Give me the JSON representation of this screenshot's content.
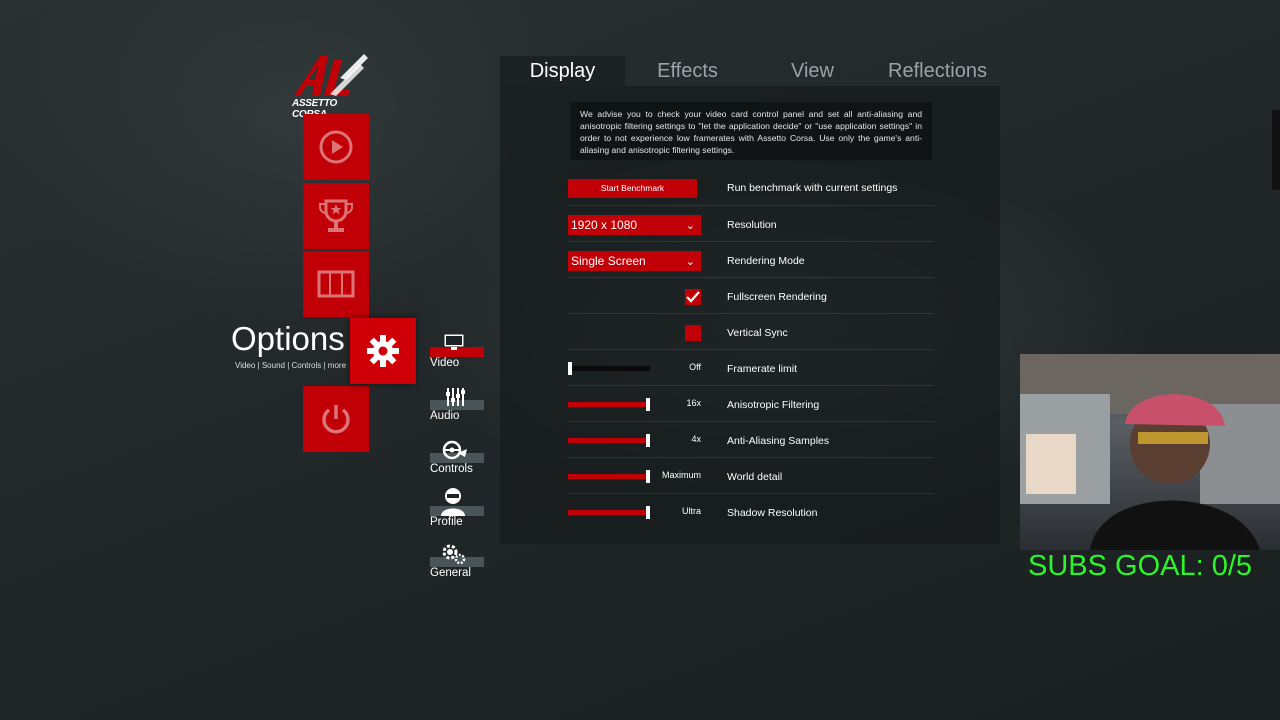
{
  "logo": {
    "text": "ASSETTO CORSA"
  },
  "main_menu": {
    "options_title": "Options",
    "options_subtitle": "Video | Sound | Controls | more"
  },
  "sub_menu": [
    {
      "label": "Video",
      "icon": "monitor-icon",
      "active": true
    },
    {
      "label": "Audio",
      "icon": "mixer-icon",
      "active": false
    },
    {
      "label": "Controls",
      "icon": "steering-wheel-icon",
      "active": false
    },
    {
      "label": "Profile",
      "icon": "driver-helmet-icon",
      "active": false
    },
    {
      "label": "General",
      "icon": "gears-icon",
      "active": false
    }
  ],
  "tabs": [
    {
      "label": "Display",
      "active": true
    },
    {
      "label": "Effects",
      "active": false
    },
    {
      "label": "View",
      "active": false
    },
    {
      "label": "Reflections",
      "active": false
    }
  ],
  "advice_text": "We advise you to check your video card control panel and set all anti-aliasing and anisotropic filtering settings to \"let the application decide\" or \"use application settings\" in order to not experience low framerates with Assetto Corsa. Use only the game's anti-aliasing and anisotropic filtering settings.",
  "settings": {
    "benchmark": {
      "button": "Start Benchmark",
      "label": "Run benchmark with current settings"
    },
    "resolution": {
      "value": "1920 x 1080",
      "label": "Resolution"
    },
    "rendering_mode": {
      "value": "Single Screen",
      "label": "Rendering Mode"
    },
    "fullscreen": {
      "label": "Fullscreen Rendering",
      "checked": true
    },
    "vsync": {
      "label": "Vertical Sync",
      "checked": false
    },
    "framerate_limit": {
      "label": "Framerate limit",
      "value": "Off",
      "level": 0.0
    },
    "anisotropic": {
      "label": "Anisotropic Filtering",
      "value": "16x",
      "level": 1.0
    },
    "antialiasing": {
      "label": "Anti-Aliasing Samples",
      "value": "4x",
      "level": 1.0
    },
    "world_detail": {
      "label": "World detail",
      "value": "Maximum",
      "level": 1.0
    },
    "shadow_resolution": {
      "label": "Shadow Resolution",
      "value": "Ultra",
      "level": 1.0
    }
  },
  "overlay": {
    "subs_goal": "SUBS GOAL: 0/5"
  },
  "colors": {
    "accent": "#c00006",
    "goal_text": "#2cf52c"
  }
}
